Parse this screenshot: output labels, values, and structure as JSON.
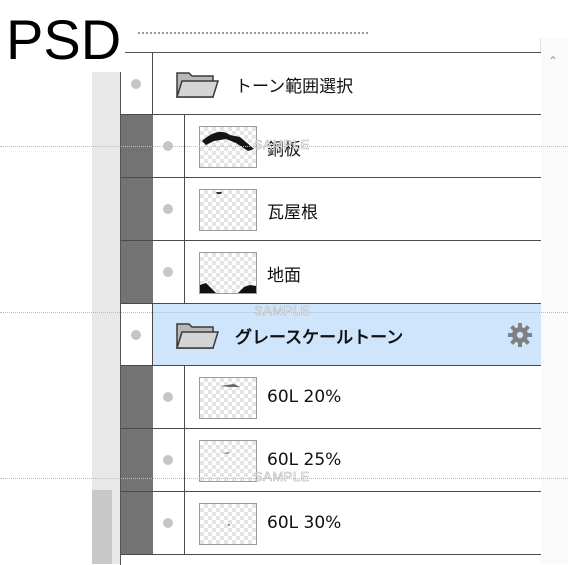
{
  "badge": {
    "text": "PSD"
  },
  "watermark": {
    "text": "SAMPLE"
  },
  "layers": [
    {
      "kind": "folder",
      "name": "トーン範囲選択",
      "bold": false,
      "selected": false,
      "indent": false
    },
    {
      "kind": "layer",
      "name": "銅板",
      "bold": false,
      "selected": false,
      "indent": true
    },
    {
      "kind": "layer",
      "name": "瓦屋根",
      "bold": false,
      "selected": false,
      "indent": true
    },
    {
      "kind": "layer",
      "name": "地面",
      "bold": false,
      "selected": false,
      "indent": true
    },
    {
      "kind": "folder",
      "name": "グレースケールトーン",
      "bold": true,
      "selected": true,
      "indent": false,
      "has_settings_icon": true
    },
    {
      "kind": "layer",
      "name": "60L 20%",
      "bold": false,
      "selected": false,
      "indent": true
    },
    {
      "kind": "layer",
      "name": "60L 25%",
      "bold": false,
      "selected": false,
      "indent": true
    },
    {
      "kind": "layer",
      "name": "60L 30%",
      "bold": false,
      "selected": false,
      "indent": true
    }
  ],
  "colors": {
    "selected_row": "#cfe5fb",
    "indent_bar": "#737373"
  },
  "icons": {
    "folder": "folder-icon",
    "settings": "gear-icon",
    "visibility": "visibility-dot-icon",
    "scroll": "scroll-up-icon"
  }
}
